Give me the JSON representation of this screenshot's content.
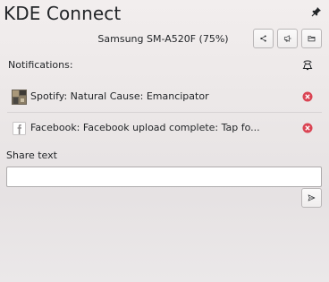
{
  "window": {
    "title": "KDE Connect"
  },
  "device": {
    "label": "Samsung SM-A520F (75%)"
  },
  "toolbar": {
    "buttons": [
      {
        "icon": "share-icon"
      },
      {
        "icon": "megaphone-icon"
      },
      {
        "icon": "folder-icon"
      }
    ]
  },
  "notifications": {
    "header": "Notifications:",
    "dismiss_all_icon": "bell-clear-icon",
    "items": [
      {
        "app_icon": "spotify-app-icon",
        "text": "Spotify: Natural Cause: Emancipator",
        "close_icon": "close-icon"
      },
      {
        "app_icon": "facebook-app-icon",
        "text": "Facebook: Facebook upload complete: Tap fo...",
        "close_icon": "close-icon"
      }
    ]
  },
  "share": {
    "label": "Share text",
    "value": "",
    "placeholder": "",
    "send_icon": "send-icon"
  },
  "colors": {
    "close_red": "#da4453",
    "border": "#b9b6b7"
  }
}
